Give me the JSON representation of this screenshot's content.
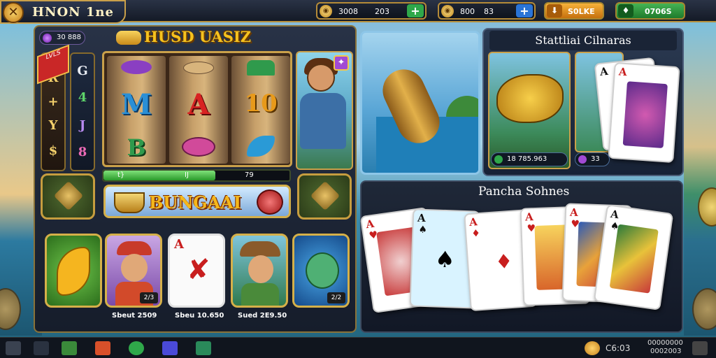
{
  "header": {
    "logo_text": "HNON 1ne",
    "logo_icon": "crossed-tools-icon",
    "resource_1": {
      "label": "3008",
      "value": "203",
      "button": "+"
    },
    "resource_2": {
      "label": "800",
      "value": "83",
      "button": "+"
    },
    "pill_orange": {
      "label": "S0LKE"
    },
    "pill_green": {
      "label": "0706S"
    }
  },
  "left_panel": {
    "bonus_value": "30 888",
    "title": "HUSD UASIZ",
    "ribbon_text": "LVLS",
    "side_left": [
      "R",
      "+",
      "Y",
      "$"
    ],
    "side_right": [
      "G",
      "4",
      "J",
      "8"
    ],
    "reels": [
      {
        "mid": "M",
        "mid_color": "#2a8fd6",
        "low": "B",
        "low_color": "#2f9a4c"
      },
      {
        "mid": "A",
        "mid_color": "#d82222",
        "low": "",
        "low_color": "#d14a9a"
      },
      {
        "mid": "10",
        "mid_color": "#e89a1a",
        "low": "",
        "low_color": "#2a9ad6"
      }
    ],
    "progress": {
      "left": "t}",
      "center": "IJ",
      "right": "79",
      "fraction": 0.6
    },
    "banner_text": "BUNGAAI"
  },
  "tiles": [
    {
      "name": "banana-tile",
      "tag": ""
    },
    {
      "name": "cowgirl-tile",
      "tag": "2/3"
    },
    {
      "name": "ace-tile",
      "tag": ""
    },
    {
      "name": "explorer-tile",
      "tag": ""
    },
    {
      "name": "turtle-tile",
      "tag": "2/2"
    }
  ],
  "tile_captions": [
    "Sbeut 2509",
    "Sbeu 10.650",
    "Sued 2E9.50"
  ],
  "right_panel": {
    "title": "Stattliai Cilnaras",
    "stat_1": "18  785.963",
    "stat_2": "33"
  },
  "bottom_panel": {
    "title": "Pancha Sohnes",
    "cards": [
      {
        "rank": "A",
        "suit": "♥",
        "color": "#c81e1e"
      },
      {
        "rank": "A",
        "suit": "♠",
        "color": "#111111"
      },
      {
        "rank": "A",
        "suit": "♦",
        "color": "#c81e1e"
      },
      {
        "rank": "A",
        "suit": "♥",
        "color": "#c81e1e"
      },
      {
        "rank": "A",
        "suit": "♥",
        "color": "#c81e1e"
      },
      {
        "rank": "A",
        "suit": "♠",
        "color": "#111111"
      }
    ]
  },
  "taskbar": {
    "clock": "C6:03",
    "date_line1": "00000000",
    "date_line2": "0002003"
  },
  "colors": {
    "gold": "#c9a04a",
    "accent_green": "#2fa84a",
    "accent_blue": "#2a74d6",
    "accent_orange": "#e88a1a"
  }
}
